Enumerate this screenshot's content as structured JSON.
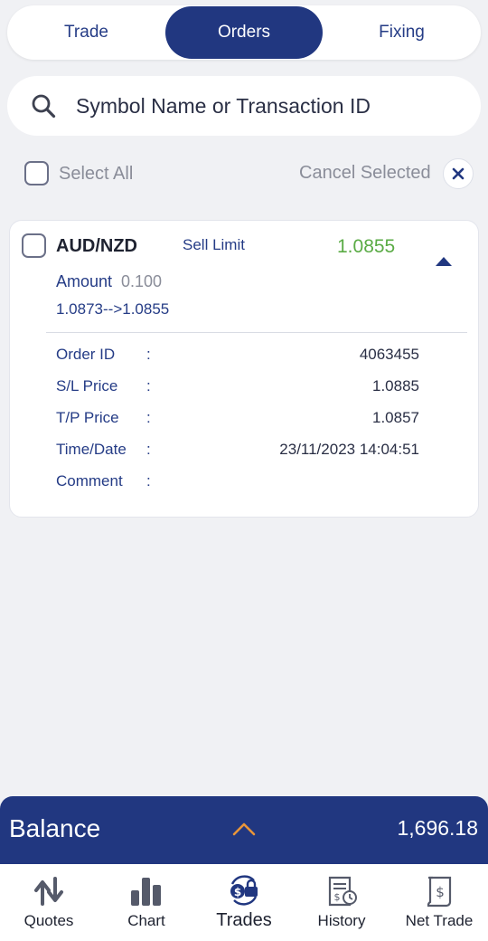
{
  "tabs": [
    {
      "label": "Trade",
      "active": false
    },
    {
      "label": "Orders",
      "active": true
    },
    {
      "label": "Fixing",
      "active": false
    }
  ],
  "search": {
    "placeholder": "Symbol Name or Transaction ID",
    "icon": "search-icon"
  },
  "selection": {
    "select_all_label": "Select All",
    "cancel_selected_label": "Cancel Selected",
    "cancel_icon": "close-icon"
  },
  "order": {
    "symbol": "AUD/NZD",
    "type": "Sell Limit",
    "price": "1.0855",
    "amount_label": "Amount",
    "amount_value": "0.100",
    "price_range": "1.0873-->1.0855",
    "details": [
      {
        "label": "Order ID",
        "colon": ":",
        "value": "4063455"
      },
      {
        "label": "S/L Price",
        "colon": ":",
        "value": "1.0885"
      },
      {
        "label": "T/P Price",
        "colon": ":",
        "value": "1.0857"
      },
      {
        "label": "Time/Date",
        "colon": ":",
        "value": "23/11/2023 14:04:51"
      },
      {
        "label": "Comment",
        "colon": ":",
        "value": ""
      }
    ]
  },
  "balance": {
    "label": "Balance",
    "value": "1,696.18"
  },
  "nav": [
    {
      "label": "Quotes",
      "icon": "quotes-icon",
      "active": false
    },
    {
      "label": "Chart",
      "icon": "chart-icon",
      "active": false
    },
    {
      "label": "Trades",
      "icon": "trades-icon",
      "active": true
    },
    {
      "label": "History",
      "icon": "history-icon",
      "active": false
    },
    {
      "label": "Net Trade",
      "icon": "net-trade-icon",
      "active": false
    }
  ],
  "colors": {
    "primary": "#213780",
    "price_green": "#5aab45",
    "accent_orange": "#e8953a",
    "background": "#f0f1f4"
  }
}
